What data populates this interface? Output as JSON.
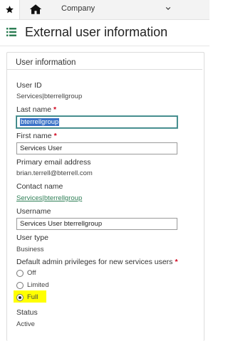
{
  "topbar": {
    "company_label": "Company",
    "icons": [
      "star-icon",
      "home-icon",
      "chevron-down-icon"
    ]
  },
  "header": {
    "title": "External user information",
    "icon": "list-icon"
  },
  "card": {
    "title": "User information"
  },
  "fields": {
    "user_id_label": "User ID",
    "user_id_value": "Services|bterrellgroup",
    "last_name_label": "Last name",
    "last_name_value": "bterrellgroup",
    "first_name_label": "First name",
    "first_name_value": "Services User",
    "email_label": "Primary email address",
    "email_value": "brian.terrell@bterrell.com",
    "contact_label": "Contact name",
    "contact_value": "Services|bterrellgroup",
    "username_label": "Username",
    "username_value": "Services User bterrellgroup",
    "user_type_label": "User type",
    "user_type_value": "Business",
    "admin_label": "Default admin privileges for new services users",
    "admin_options": [
      "Off",
      "Limited",
      "Full"
    ],
    "admin_selected": "Full",
    "status_label": "Status",
    "status_value": "Active",
    "required_mark": "*"
  },
  "colors": {
    "accent_green": "#2f7f56",
    "required_red": "#d0021b",
    "highlight_yellow": "#ffff00",
    "selection_blue": "#3b73c7"
  }
}
